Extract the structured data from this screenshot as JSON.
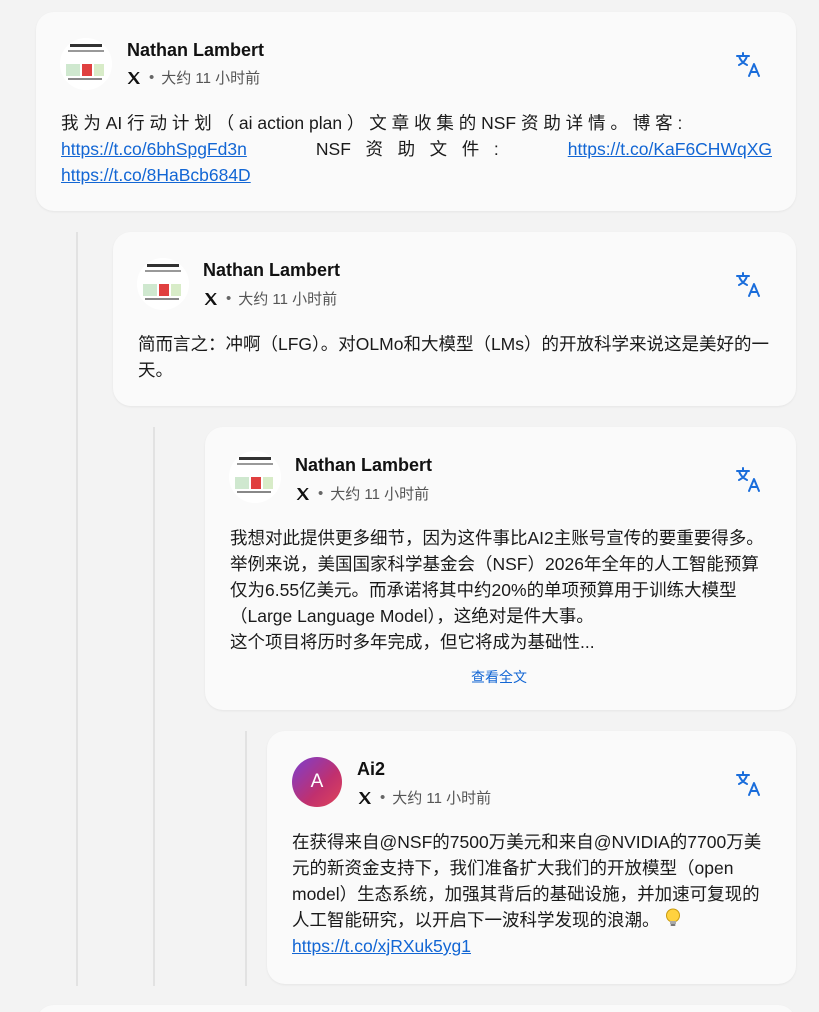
{
  "posts": [
    {
      "author": "Nathan Lambert",
      "time": "大约 11 小时前",
      "text_line1": "我 为 AI 行 动 计 划 （ ai  action  plan ） 文 章 收 集 的 NSF 资 助 详 情 。  博 客 :",
      "link_blog": "https://t.co/6bhSpgFd3n",
      "label_docs": "NSF   资   助   文   件   :",
      "link_docs": "https://t.co/KaF6CHWqXG",
      "link_third": "https://t.co/8HaBcb684D"
    },
    {
      "author": "Nathan Lambert",
      "time": "大约 11 小时前",
      "text": "简而言之：冲啊（LFG）。对OLMo和大模型（LMs）的开放科学来说这是美好的一天。"
    },
    {
      "author": "Nathan Lambert",
      "time": "大约 11 小时前",
      "text": "我想对此提供更多细节，因为这件事比AI2主账号宣传的要重要得多。举例来说，美国国家科学基金会（NSF）2026年全年的人工智能预算仅为6.55亿美元。而承诺将其中约20%的单项预算用于训练大模型（Large Language Model），这绝对是件大事。",
      "text2": "这个项目将历时多年完成，但它将成为基础性...",
      "see_more": "查看全文"
    },
    {
      "author": "Ai2",
      "avatar_letter": "A",
      "time": "大约 11 小时前",
      "text": "在获得来自@NSF的7500万美元和来自@NVIDIA的7700万美元的新资金支持下，我们准备扩大我们的开放模型（open model）生态系统，加强其背后的基础设施，并加速可复现的人工智能研究，以开启下一波科学发现的浪潮。",
      "link": "https://t.co/xjRXuk5yg1"
    }
  ],
  "icons": {
    "source": "x-logo-icon",
    "translate": "translate-icon",
    "emoji": "lightbulb-icon"
  },
  "colors": {
    "link": "#1266d4",
    "translate": "#1a6ddb",
    "card": "#fafafa",
    "background": "#f3f3f3"
  }
}
